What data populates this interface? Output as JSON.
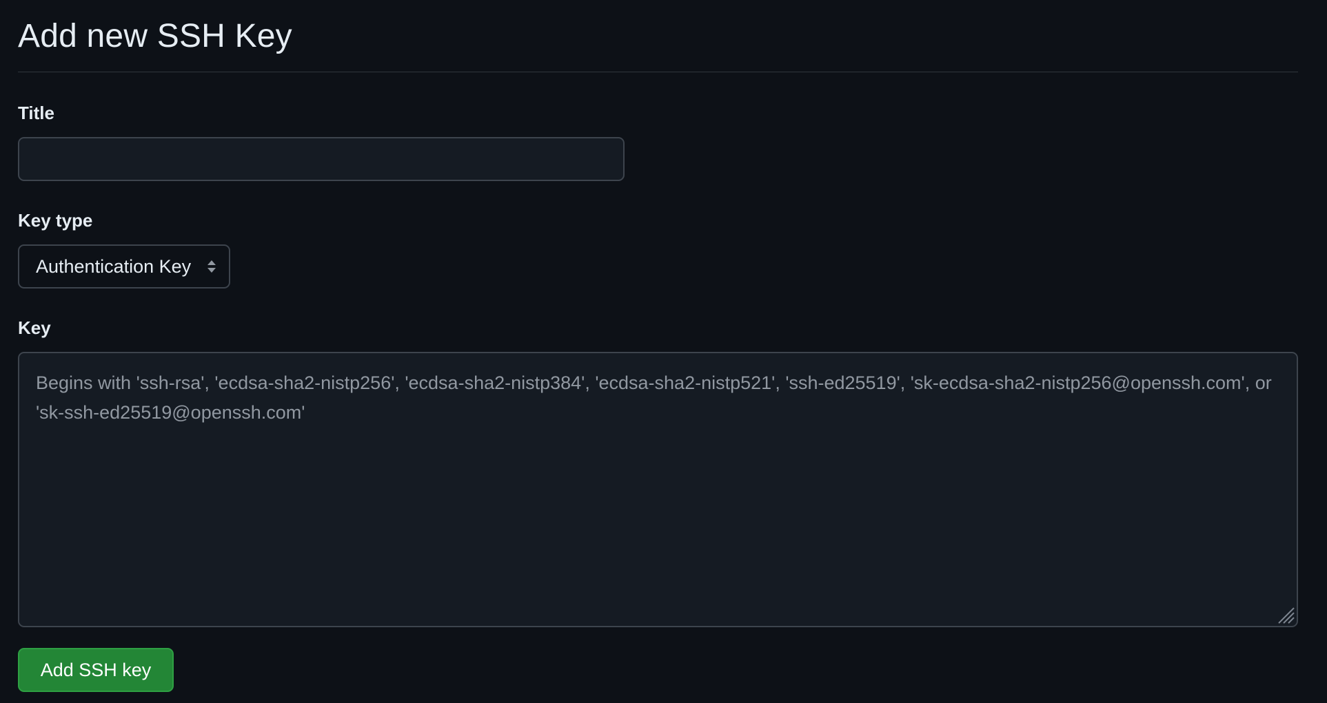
{
  "page": {
    "title": "Add new SSH Key"
  },
  "form": {
    "title_field": {
      "label": "Title",
      "value": "",
      "placeholder": ""
    },
    "key_type": {
      "label": "Key type",
      "selected": "Authentication Key"
    },
    "key_field": {
      "label": "Key",
      "value": "",
      "placeholder": "Begins with 'ssh-rsa', 'ecdsa-sha2-nistp256', 'ecdsa-sha2-nistp384', 'ecdsa-sha2-nistp521', 'ssh-ed25519', 'sk-ecdsa-sha2-nistp256@openssh.com', or 'sk-ssh-ed25519@openssh.com'"
    },
    "submit_label": "Add SSH key"
  },
  "icons": {
    "select_caret": "select-caret-icon",
    "resize_handle": "resize-grip-icon"
  },
  "colors": {
    "background": "#0d1117",
    "input_background": "#151b23",
    "border": "#3d444d",
    "text": "#e6edf3",
    "placeholder": "#9198a1",
    "button_green": "#238636"
  }
}
